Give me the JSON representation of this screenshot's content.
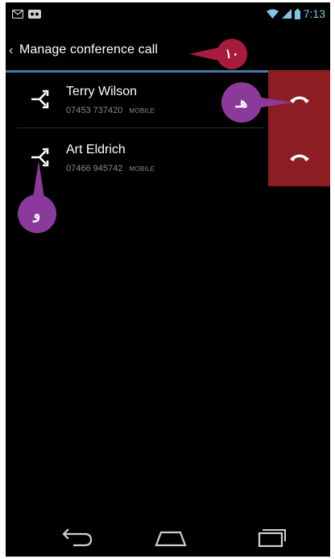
{
  "status_bar": {
    "time": "7:13",
    "left_icons": [
      "message-icon",
      "voicemail-icon"
    ],
    "right_icons": [
      "wifi-icon",
      "signal-icon",
      "battery-icon"
    ]
  },
  "action_bar": {
    "title": "Manage conference call",
    "back_icon": "chevron-left-icon"
  },
  "calls": [
    {
      "name": "Terry Wilson",
      "number": "07453 737420",
      "type": "MOBILE",
      "action_icon": "split-call-icon",
      "end_icon": "end-call-icon"
    },
    {
      "name": "Art Eldrich",
      "number": "07466 945742",
      "type": "MOBILE",
      "action_icon": "split-call-icon",
      "end_icon": "end-call-icon"
    }
  ],
  "annotations": {
    "title_callout": "١٠",
    "end_call_callout": "هـ",
    "split_callout": "و"
  },
  "nav_bar": {
    "icons": [
      "back-nav-icon",
      "home-nav-icon",
      "recents-nav-icon"
    ]
  },
  "colors": {
    "background": "#000000",
    "accent_divider": "#3c7fa3",
    "end_call_panel": "#8c1d22",
    "callout_red": "#a91b3c",
    "callout_purple": "#8b3a9c"
  }
}
